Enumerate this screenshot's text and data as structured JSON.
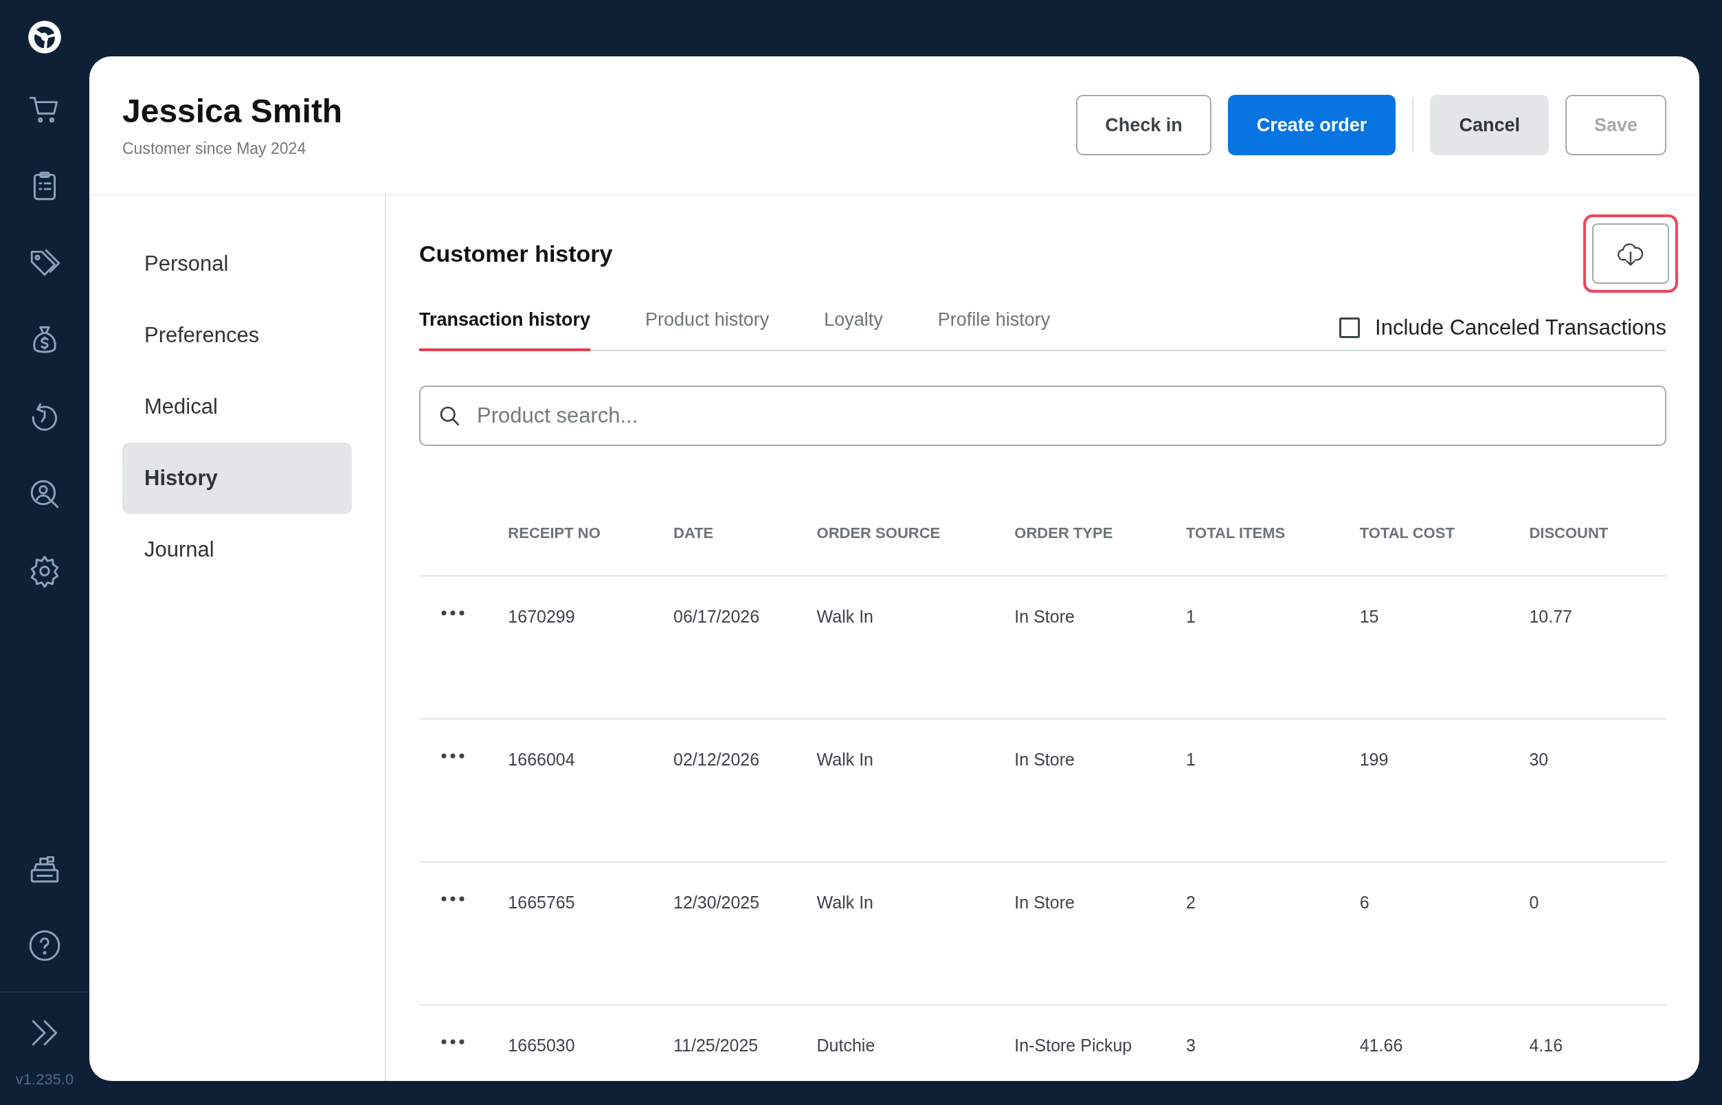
{
  "app_bar": {
    "version": "v1.235.0"
  },
  "customer": {
    "name": "Jessica Smith",
    "since": "Customer since May 2024"
  },
  "header_buttons": [
    {
      "label": "Check in",
      "kind": "outline",
      "disabled": false
    },
    {
      "label": "Create order",
      "kind": "primary",
      "disabled": false
    },
    {
      "label": "Cancel",
      "kind": "secondary",
      "disabled": false
    },
    {
      "label": "Save",
      "kind": "outline",
      "disabled": true
    }
  ],
  "nav": [
    {
      "label": "Personal",
      "selected": false
    },
    {
      "label": "Preferences",
      "selected": false
    },
    {
      "label": "Medical",
      "selected": false
    },
    {
      "label": "History",
      "selected": true
    },
    {
      "label": "Journal",
      "selected": false
    }
  ],
  "section": {
    "title": "Customer history",
    "download_highlighted": true
  },
  "tabs": [
    {
      "label": "Transaction history",
      "selected": true
    },
    {
      "label": "Product history",
      "selected": false
    },
    {
      "label": "Loyalty",
      "selected": false
    },
    {
      "label": "Profile history",
      "selected": false
    }
  ],
  "include_canceled": {
    "label": "Include Canceled Transactions",
    "checked": false
  },
  "search": {
    "placeholder": "Product search..."
  },
  "table": {
    "columns": [
      "RECEIPT NO",
      "DATE",
      "ORDER SOURCE",
      "ORDER TYPE",
      "TOTAL ITEMS",
      "TOTAL COST",
      "DISCOUNT"
    ],
    "rows": [
      [
        "1670299",
        "06/17/2026",
        "Walk In",
        "In Store",
        "1",
        "15",
        "10.77"
      ],
      [
        "1666004",
        "02/12/2026",
        "Walk In",
        "In Store",
        "1",
        "199",
        "30"
      ],
      [
        "1665765",
        "12/30/2025",
        "Walk In",
        "In Store",
        "2",
        "6",
        "0"
      ],
      [
        "1665030",
        "11/25/2025",
        "Dutchie",
        "In-Store Pickup",
        "3",
        "41.66",
        "4.16"
      ]
    ]
  }
}
